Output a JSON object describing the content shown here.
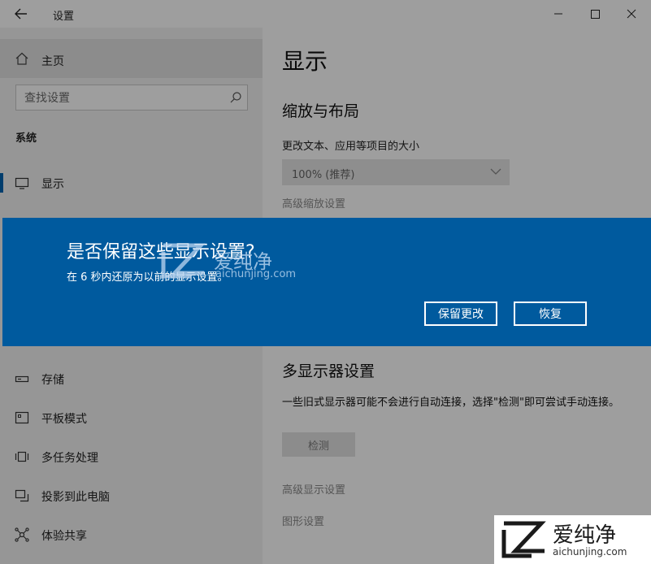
{
  "window": {
    "title": "设置",
    "controls": {
      "minimize": "minimize-icon",
      "maximize": "maximize-icon",
      "close": "close-icon"
    }
  },
  "sidebar": {
    "home_label": "主页",
    "search_placeholder": "查找设置",
    "section_title": "系统",
    "items": [
      {
        "label": "显示",
        "icon": "monitor-icon",
        "selected": true
      },
      {
        "label": "存储",
        "icon": "storage-icon"
      },
      {
        "label": "平板模式",
        "icon": "tablet-icon"
      },
      {
        "label": "多任务处理",
        "icon": "multitask-icon"
      },
      {
        "label": "投影到此电脑",
        "icon": "project-icon"
      },
      {
        "label": "体验共享",
        "icon": "share-icon"
      }
    ]
  },
  "main": {
    "page_title": "显示",
    "scale_section_title": "缩放与布局",
    "scale_label": "更改文本、应用等项目的大小",
    "scale_value": "100% (推荐)",
    "advanced_scaling_link": "高级缩放设置",
    "multi_display_title": "多显示器设置",
    "multi_display_desc": "一些旧式显示器可能不会进行自动连接，选择\"检测\"即可尝试手动连接。",
    "detect_button": "检测",
    "advanced_display_link": "高级显示设置",
    "graphics_link": "图形设置"
  },
  "dialog": {
    "title": "是否保留这些显示设置?",
    "message": "在  6 秒内还原为以前的显示设置。",
    "keep_button": "保留更改",
    "revert_button": "恢复",
    "background_color": "#005a9e"
  },
  "watermark": {
    "brand": "爱纯净",
    "url": "aichunjing.com"
  }
}
